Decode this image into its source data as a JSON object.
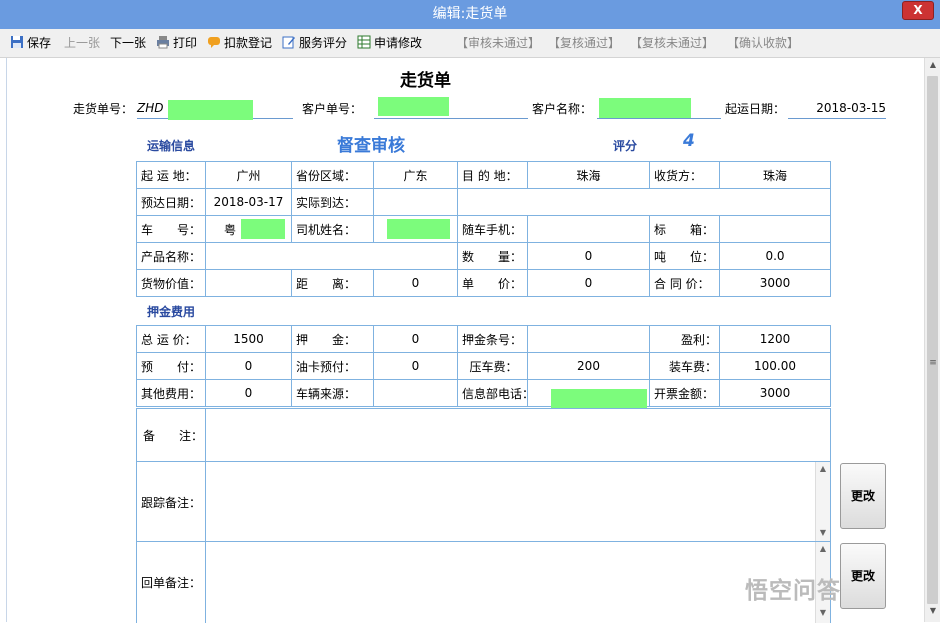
{
  "window": {
    "title": "编辑:走货单",
    "close": "X"
  },
  "toolbar": {
    "save": "保存",
    "prev": "上一张",
    "next": "下一张",
    "print": "打印",
    "deduct": "扣款登记",
    "rating": "服务评分",
    "apply_modify": "申请修改",
    "audit_fail": "【审核未通过】",
    "recheck_pass": "【复核通过】",
    "recheck_fail": "【复核未通过】",
    "confirm_receipt": "【确认收款】"
  },
  "form": {
    "title": "走货单",
    "order_no_label": "走货单号：",
    "order_no": "ZHD",
    "customer_no_label": "客户单号：",
    "customer_name_label": "客户名称：",
    "ship_date_label": "起运日期：",
    "ship_date": "2018-03-15",
    "section_transport": "运输信息",
    "audit_status": "督查审核",
    "score_label": "评分",
    "score_value": "4",
    "section_fees": "押金费用"
  },
  "transport": {
    "r1": {
      "origin_lbl": "起 运 地：",
      "origin": "广州",
      "province_lbl": "省份区域：",
      "province": "广东",
      "dest_lbl": "目 的 地：",
      "dest": "珠海",
      "receiver_lbl": "收货方：",
      "receiver": "珠海"
    },
    "r2": {
      "eta_lbl": "预达日期：",
      "eta": "2018-03-17",
      "actual_lbl": "实际到达：",
      "actual": ""
    },
    "r3": {
      "plate_lbl": "车　　号：",
      "plate": "粤",
      "driver_lbl": "司机姓名：",
      "mobile_lbl": "随车手机：",
      "mobile": "",
      "box_lbl": "标　　箱：",
      "box": ""
    },
    "r4": {
      "product_lbl": "产品名称：",
      "product": "",
      "qty_lbl": "数　　量：",
      "qty": "0",
      "tons_lbl": "吨　　位：",
      "tons": "0.0"
    },
    "r5": {
      "value_lbl": "货物价值：",
      "value": "",
      "dist_lbl": "距　　离：",
      "dist": "0",
      "unit_lbl": "单　　价：",
      "unit": "0",
      "contract_lbl": "合 同 价：",
      "contract": "3000"
    }
  },
  "fees": {
    "r1": {
      "total_lbl": "总 运 价：",
      "total": "1500",
      "deposit_lbl": "押　　金：",
      "deposit": "0",
      "deposit_no_lbl": "押金条号：",
      "deposit_no": "",
      "profit_lbl": "盈利：",
      "profit": "1200"
    },
    "r2": {
      "prepay_lbl": "预　　付：",
      "prepay": "0",
      "fuel_lbl": "油卡预付：",
      "fuel": "0",
      "press_lbl": "压车费：",
      "press": "200",
      "loading_lbl": "装车费：",
      "loading": "100.00"
    },
    "r3": {
      "other_lbl": "其他费用：",
      "other": "0",
      "source_lbl": "车辆来源：",
      "source": "",
      "phone_lbl": "信息部电话：",
      "invoice_lbl": "开票金额：",
      "invoice": "3000"
    }
  },
  "remarks": {
    "note_lbl": "备　　注：",
    "track_lbl": "跟踪备注：",
    "return_lbl": "回单备注："
  },
  "buttons": {
    "modify1": "更改",
    "modify2": "更改"
  },
  "watermark": "悟空问答",
  "colors": {
    "titlebar": "#6a9be0",
    "grid_border": "#7fb2e0",
    "accent_blue": "#3a7ad8",
    "redacted": "#7cfc7c"
  }
}
